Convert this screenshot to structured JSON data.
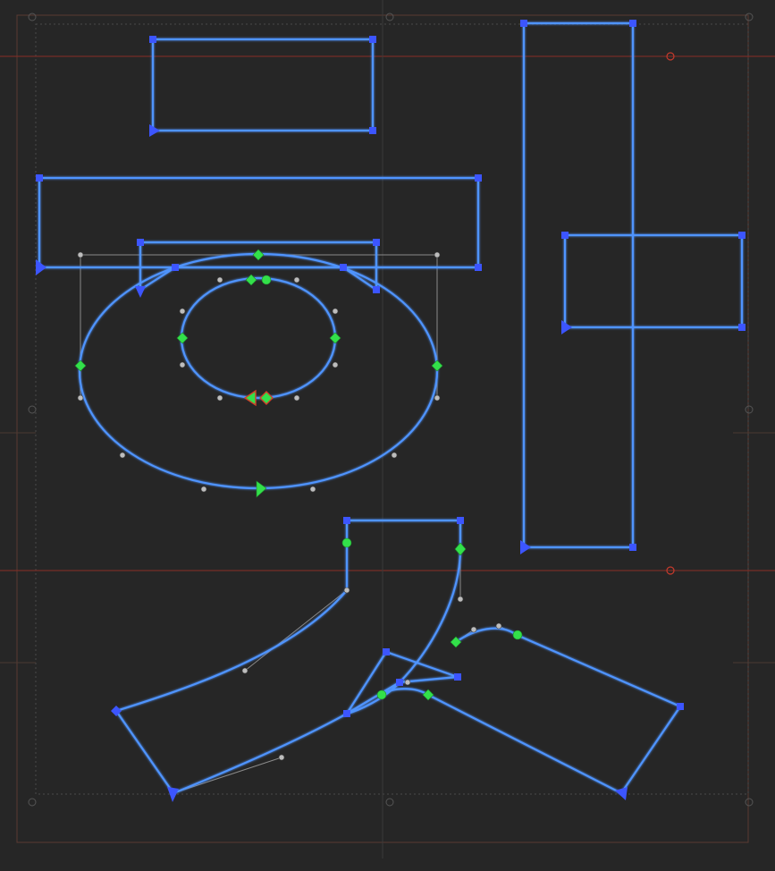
{
  "editor": {
    "colors": {
      "background": "#262626",
      "outline": "#4f94ff",
      "outline_glow": "#d8eaff",
      "node_corner": "#3c55ff",
      "node_smooth": "#33e04a",
      "handle": "#bdbdbd",
      "guide_metric": "#8a2d25",
      "guide_margin": "#4a4a4a",
      "selected_node": "#d0402a"
    },
    "icons": {
      "corner_node": "blue-square-node-icon",
      "smooth_node": "green-diamond-node-icon",
      "start_node": "blue-triangle-start-icon",
      "handle": "gray-handle-dot-icon"
    }
  }
}
